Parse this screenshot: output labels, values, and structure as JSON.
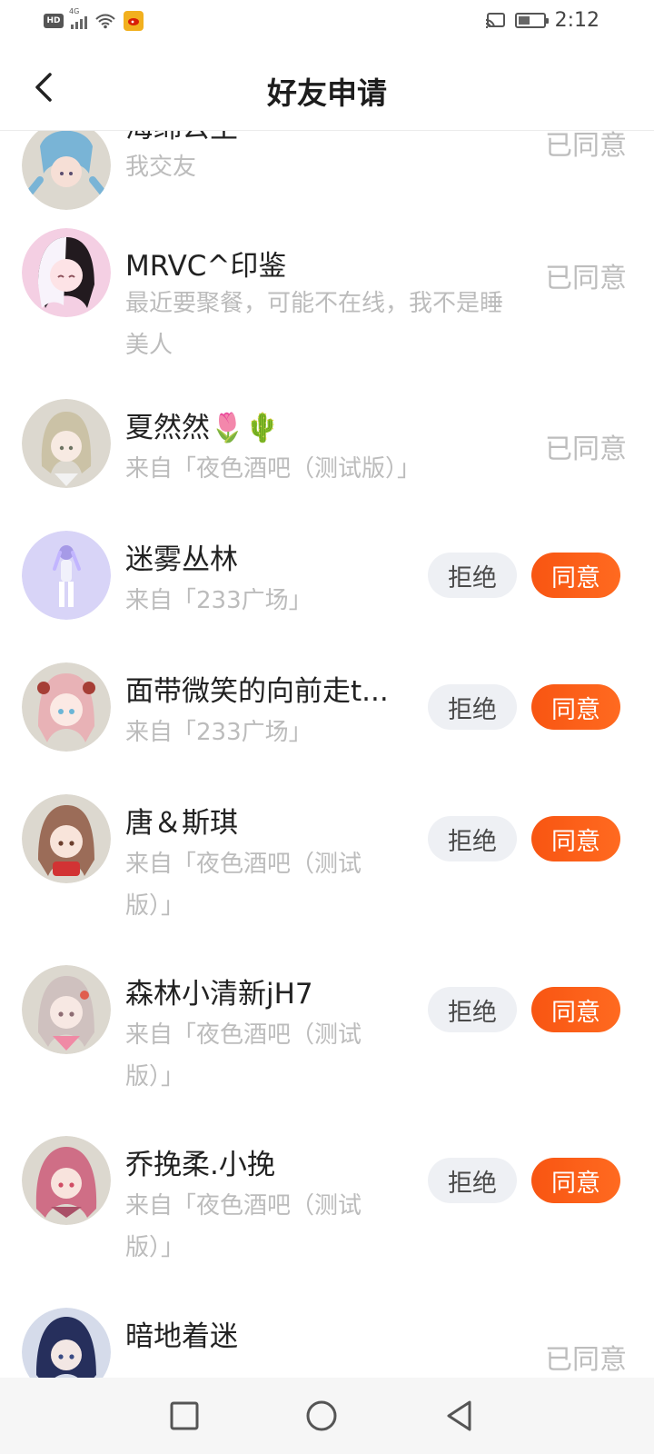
{
  "status_bar": {
    "hd_label": "HD",
    "network_label": "4G",
    "time": "2:12"
  },
  "header": {
    "title": "好友申请"
  },
  "requests": [
    {
      "name": "海绵公主",
      "subtext": "我交友",
      "state": "已同意",
      "avatar_theme": "blue-haired-girl"
    },
    {
      "name": "MRVC^印鉴",
      "subtext": "最近要聚餐，可能不在线，我不是睡美人",
      "state": "已同意",
      "avatar_theme": "pink-black-haired-girl"
    },
    {
      "name": "夏然然🌷🌵",
      "subtext": "来自「夜色酒吧（测试版）」",
      "state": "已同意",
      "avatar_theme": "blonde-girl"
    },
    {
      "name": "迷雾丛林",
      "subtext": "来自「233广场」",
      "reject_label": "拒绝",
      "accept_label": "同意",
      "avatar_theme": "purple-figure"
    },
    {
      "name": "面带微笑的向前走t...",
      "subtext": "来自「233广场」",
      "reject_label": "拒绝",
      "accept_label": "同意",
      "avatar_theme": "pink-haired-girl"
    },
    {
      "name": "唐＆斯琪",
      "subtext": "来自「夜色酒吧（测试版）」",
      "reject_label": "拒绝",
      "accept_label": "同意",
      "avatar_theme": "brown-haired-girl"
    },
    {
      "name": "森林小清新jH7",
      "subtext": "来自「夜色酒吧（测试版）」",
      "reject_label": "拒绝",
      "accept_label": "同意",
      "avatar_theme": "silver-haired-girl"
    },
    {
      "name": "乔挽柔.小挽",
      "subtext": "来自「夜色酒吧（测试版）」",
      "reject_label": "拒绝",
      "accept_label": "同意",
      "avatar_theme": "rose-haired-girl"
    },
    {
      "name": "暗地着迷",
      "state": "已同意",
      "avatar_theme": "dark-haired-person"
    }
  ],
  "icons": {
    "back": "chevron-left-icon",
    "recent_apps": "square-icon",
    "home": "circle-icon",
    "nav_back": "triangle-back-icon",
    "hd": "hd-icon",
    "network": "signal-icon",
    "wifi": "wifi-icon",
    "app": "weibo-icon",
    "cast": "cast-icon",
    "battery": "battery-icon"
  },
  "colors": {
    "accent": "#FF5E16",
    "muted_text": "#BCBCBC",
    "reject_bg": "#EEF0F4"
  }
}
